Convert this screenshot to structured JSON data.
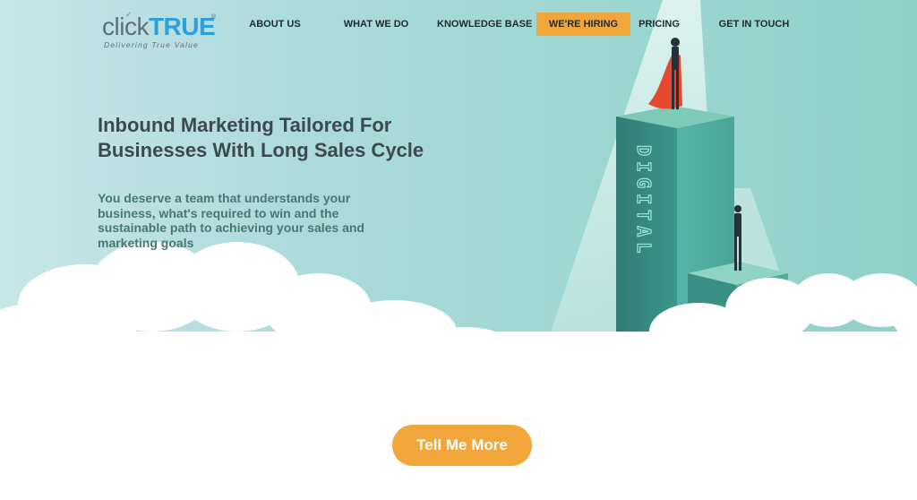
{
  "brand": {
    "logo_click": "click",
    "logo_true": "TRUE",
    "logo_trademark": "®",
    "tagline": "Delivering True Value"
  },
  "nav": {
    "items": [
      {
        "label": "ABOUT US"
      },
      {
        "label": "WHAT WE DO"
      },
      {
        "label": "KNOWLEDGE BASE"
      },
      {
        "label": "WE'RE HIRING",
        "highlighted": true
      },
      {
        "label": "PRICING"
      },
      {
        "label": "GET IN TOUCH"
      }
    ]
  },
  "hero": {
    "headline": "Inbound Marketing Tailored For Businesses With Long Sales Cycle",
    "subtext": "You deserve a team that understands your business, what's required to win and the sustainable path to achieving your sales and marketing goals",
    "pillar_text": "DIGITAL"
  },
  "cta": {
    "label": "Tell Me More"
  },
  "colors": {
    "accent": "#f1a63c",
    "brand_blue": "#2e9fd8",
    "hero_teal": "#a2d8d4",
    "pillar": "#3f9a8e"
  }
}
